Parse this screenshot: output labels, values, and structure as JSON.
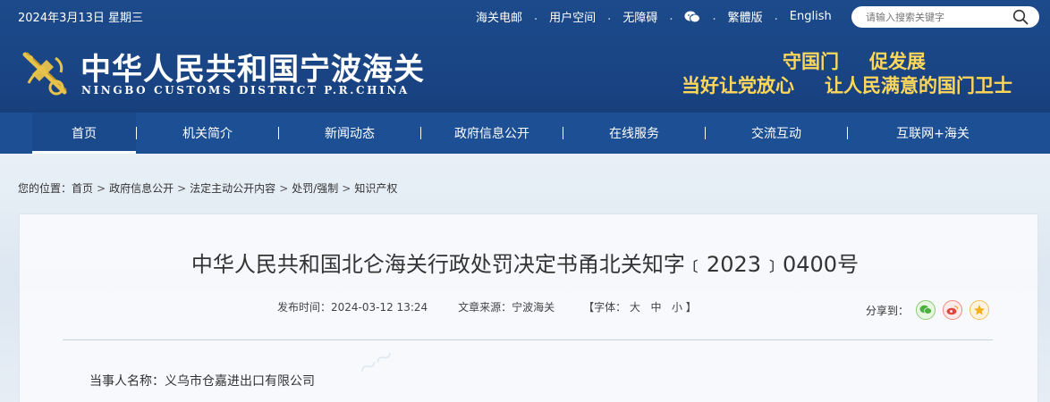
{
  "header": {
    "date": "2024年3月13日 星期三",
    "links": [
      "海关电邮",
      "用户空间",
      "无障碍",
      "繁體版",
      "English"
    ],
    "search_placeholder": "请输入搜索关键字",
    "site_name": "中华人民共和国宁波海关",
    "site_name_en": "NINGBO CUSTOMS DISTRICT P.R.CHINA",
    "slogan_line1": [
      "守国门",
      "促发展"
    ],
    "slogan_line2": [
      "当好让党放心",
      "让人民满意的国门卫士"
    ]
  },
  "nav": [
    "首页",
    "机关简介",
    "新闻动态",
    "政府信息公开",
    "在线服务",
    "交流互动",
    "互联网+海关"
  ],
  "breadcrumb": {
    "prefix": "您的位置：",
    "items": [
      "首页",
      "政府信息公开",
      "法定主动公开内容",
      "处罚/强制",
      "知识产权"
    ]
  },
  "article": {
    "title": "中华人民共和国北仑海关行政处罚决定书甬北关知字﹝2023﹞0400号",
    "publish_time": "发布时间：2024-03-12 13:24",
    "source": "文章来源：宁波海关",
    "font_label": "【字体：",
    "font_sizes": [
      "大",
      "中",
      "小"
    ],
    "font_end": "】",
    "share_label": "分享到：",
    "party": "当事人名称：义乌市仓嘉进出口有限公司"
  },
  "colors": {
    "header_bg": "#1c4a8a",
    "nav_bg": "#1c4f94",
    "slogan": "#ffd85a"
  }
}
